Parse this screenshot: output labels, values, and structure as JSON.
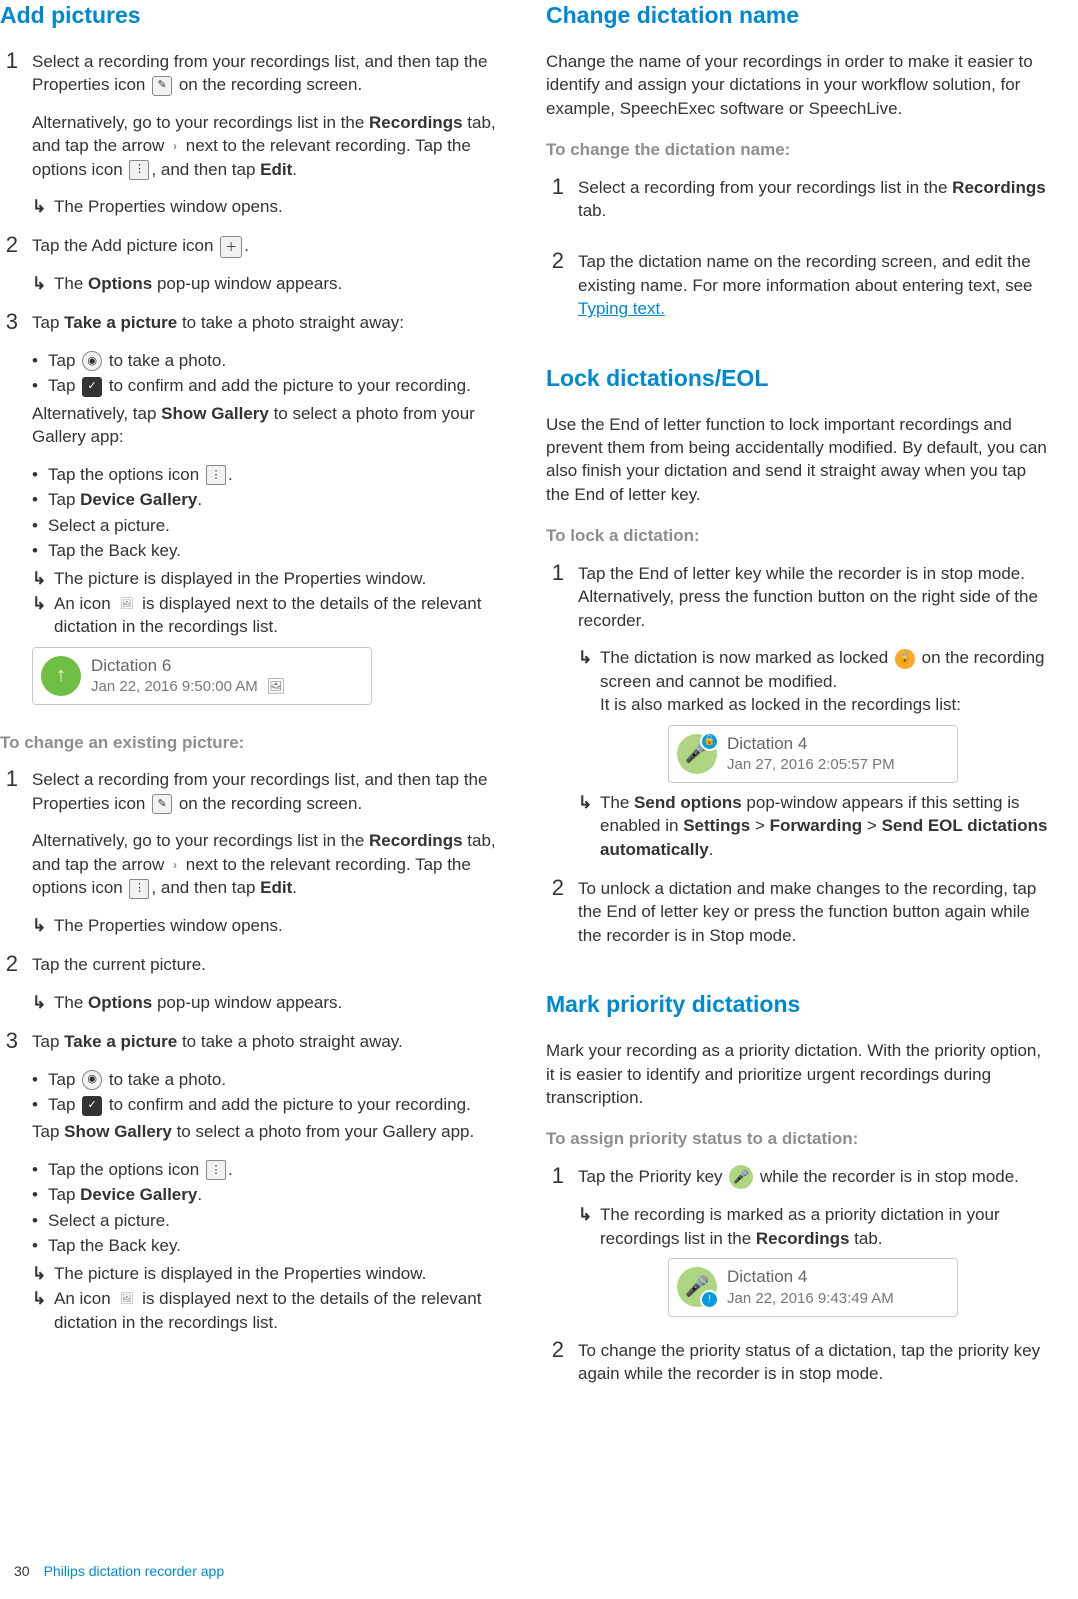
{
  "footer": {
    "page": "30",
    "app": "Philips dictation recorder app"
  },
  "left": {
    "h_add": "Add pictures",
    "add_steps": [
      {
        "n": "1",
        "p1a": "Select a recording from your recordings list, and then tap the Properties icon ",
        "p1b": " on the recording screen.",
        "p2a": "Alternatively, go to your recordings list in the ",
        "p2b": " tab, and tap the arrow ",
        "p2c": " next to the relevant recording. Tap the options icon ",
        "p2d": ", and then tap ",
        "recordings": "Recordings",
        "edit": "Edit",
        "r1": "The Properties window opens."
      },
      {
        "n": "2",
        "p1": "Tap the Add picture icon ",
        "r1a": "The ",
        "r1bold": "Options",
        "r1b": " pop-up window appears."
      },
      {
        "n": "3",
        "p1a": "Tap ",
        "p1bold": "Take a picture",
        "p1b": " to take a photo straight away:",
        "b1a": "Tap ",
        "b1b": " to take a photo.",
        "b2a": "Tap ",
        "b2b": " to confirm and add the picture to your recording.",
        "p2a": "Alternatively, tap ",
        "p2bold": "Show Gallery",
        "p2b": " to select a photo from your Gallery app:",
        "g1a": "Tap the options icon ",
        "g2a": "Tap ",
        "g2bold": "Device Gallery",
        "g2b": ".",
        "g3": "Select a picture.",
        "g4": "Tap the Back key.",
        "gr1": "The picture is displayed in the Properties window.",
        "gr2a": "An icon ",
        "gr2b": " is displayed next to the details of the relevant dictation in the recordings list."
      }
    ],
    "ss1": {
      "title": "Dictation 6",
      "sub": "Jan 22, 2016 9:50:00 AM"
    },
    "sub_change": "To change an existing picture:",
    "change_steps": [
      {
        "n": "1",
        "p1a": "Select a recording from your recordings list, and then tap the Properties icon ",
        "p1b": " on the recording screen.",
        "p2a": "Alternatively, go to your recordings list in the ",
        "p2b": " tab, and tap the arrow ",
        "p2c": " next to the relevant recording. Tap the options icon ",
        "p2d": ", and then tap ",
        "recordings": "Recordings",
        "edit": "Edit",
        "r1": "The Properties window opens."
      },
      {
        "n": "2",
        "p1": "Tap the current picture.",
        "r1a": "The ",
        "r1bold": "Options",
        "r1b": " pop-up window appears."
      },
      {
        "n": "3",
        "p1a": "Tap ",
        "p1bold": "Take a picture",
        "p1b": " to take a photo straight away.",
        "b1a": "Tap ",
        "b1b": " to take a photo.",
        "b2a": "Tap ",
        "b2b": " to confirm and add the picture to your recording.",
        "p2a": "Tap ",
        "p2bold": "Show Gallery",
        "p2b": " to select a photo from your Gallery app.",
        "g1a": "Tap the options icon ",
        "g2a": "Tap ",
        "g2bold": "Device Gallery",
        "g2b": ".",
        "g3": "Select a picture.",
        "g4": "Tap the Back key.",
        "gr1": "The picture is displayed in the Properties window.",
        "gr2a": "An icon ",
        "gr2b": " is displayed next to the details of the relevant dictation in the recordings list."
      }
    ]
  },
  "right": {
    "h_change": "Change dictation name",
    "change_p": "Change the name of your recordings in order to make it easier to identify and assign your dictations in your workflow solution, for example, SpeechExec software or SpeechLive.",
    "sub_change": "To change the dictation name:",
    "change_steps": [
      {
        "n": "1",
        "p1a": "Select a recording from your recordings list in the ",
        "recordings": "Recordings",
        "p1b": " tab."
      },
      {
        "n": "2",
        "p1": "Tap the dictation name on the recording screen, and edit the existing name. For more information about entering text, see ",
        "link": "Typing text."
      }
    ],
    "h_lock": "Lock dictations/EOL",
    "lock_p": "Use the End of letter function to lock important recordings and prevent them from being accidentally modified. By default, you can also finish your dictation and send it straight away when you tap the End of letter key.",
    "sub_lock": "To lock a dictation:",
    "lock_steps": [
      {
        "n": "1",
        "p1": "Tap the End of letter key while the recorder is in stop mode. Alternatively, press the function button on the right side of the recorder.",
        "r1a": "The dictation is now marked as locked ",
        "r1b": " on the recording screen and cannot be modified.",
        "r1c": "It is also marked as locked in the recordings list:",
        "r2a": "The ",
        "r2bold": "Send options",
        "r2b": " pop-window appears if this setting is enabled in ",
        "set": "Settings",
        "gt": " > ",
        "fwd": "Forwarding",
        "r2c": " > ",
        "eol": "Send EOL dictations automatically",
        "r2d": "."
      },
      {
        "n": "2",
        "p1": "To unlock a dictation and make changes to the recording, tap the End of letter key or press the function button again while the recorder is in Stop mode."
      }
    ],
    "ss_lock": {
      "title": "Dictation 4",
      "sub": "Jan 27, 2016 2:05:57 PM"
    },
    "h_prio": "Mark priority dictations",
    "prio_p": "Mark your recording as a priority dictation. With the priority option, it is easier to identify and prioritize urgent recordings during transcription.",
    "sub_prio": "To assign priority status to a dictation:",
    "prio_steps": [
      {
        "n": "1",
        "p1a": "Tap the Priority key ",
        "p1b": " while the recorder is in stop mode.",
        "r1a": "The recording is marked as a priority dictation in your recordings list in the ",
        "recordings": "Recordings",
        "r1b": " tab."
      },
      {
        "n": "2",
        "p1": "To change the priority status of a dictation, tap the priority key again while the recorder is in stop mode."
      }
    ],
    "ss_prio": {
      "title": "Dictation 4",
      "sub": "Jan 22, 2016 9:43:49 AM"
    }
  }
}
